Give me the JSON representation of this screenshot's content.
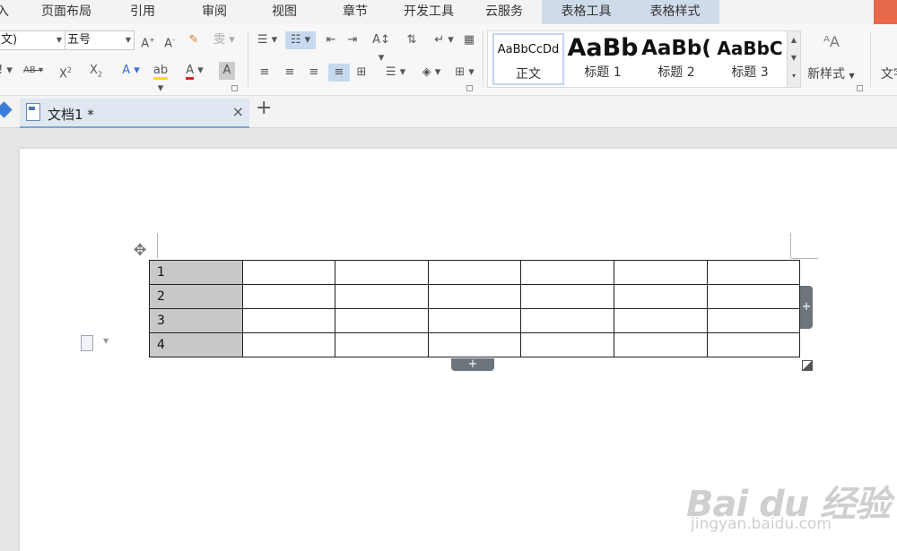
{
  "menu": {
    "items": [
      "入",
      "页面布局",
      "引用",
      "审阅",
      "视图",
      "章节",
      "开发工具",
      "云服务",
      "表格工具",
      "表格样式"
    ]
  },
  "ribbon": {
    "font_name": "文)",
    "font_size": "五号",
    "styles": [
      {
        "sample": "AaBbCcDd",
        "label": "正文"
      },
      {
        "sample": "AaBb",
        "label": "标题 1"
      },
      {
        "sample": "AaBb(",
        "label": "标题 2"
      },
      {
        "sample": "AaBbC",
        "label": "标题 3"
      }
    ],
    "new_style_label": "新样式",
    "text_tools_label": "文字"
  },
  "tabs": {
    "doc_title": "文档1 *",
    "close": "×",
    "new_tab": "+"
  },
  "table": {
    "rows": [
      [
        "1",
        "",
        "",
        "",
        "",
        "",
        ""
      ],
      [
        "2",
        "",
        "",
        "",
        "",
        "",
        ""
      ],
      [
        "3",
        "",
        "",
        "",
        "",
        "",
        ""
      ],
      [
        "4",
        "",
        "",
        "",
        "",
        "",
        ""
      ]
    ]
  },
  "watermark": {
    "main": "Bai du 经验",
    "sub": "jingyan.baidu.com"
  },
  "colors": {
    "context_tab": "#cfdbe9",
    "header_cell": "#c8c8c8",
    "accent": "#e8684a"
  }
}
